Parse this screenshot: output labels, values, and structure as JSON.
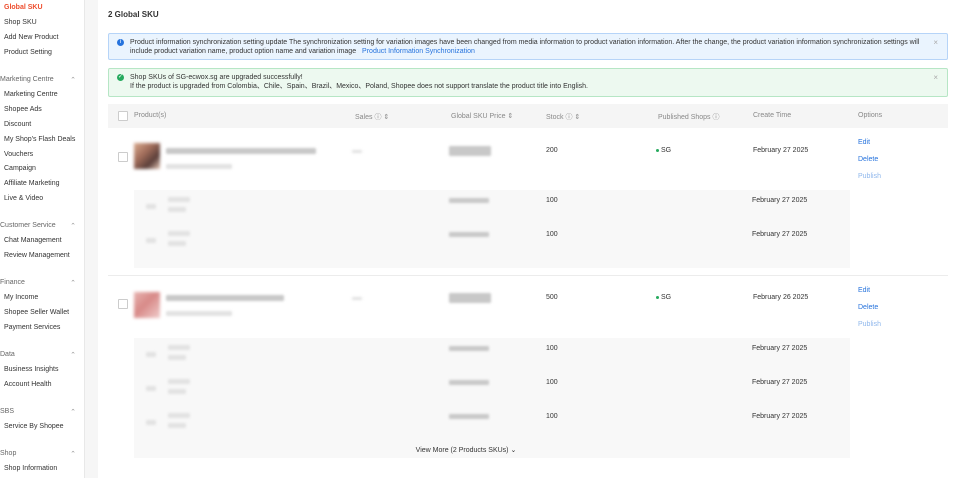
{
  "sidebar": {
    "top_items": [
      "Global SKU",
      "Shop SKU",
      "Add New Product",
      "Product Setting"
    ],
    "groups": [
      {
        "title": "Marketing Centre",
        "items": [
          "Marketing Centre",
          "Shopee Ads",
          "Discount",
          "My Shop's Flash Deals",
          "Vouchers",
          "Campaign",
          "Affiliate Marketing",
          "Live & Video"
        ]
      },
      {
        "title": "Customer Service",
        "items": [
          "Chat Management",
          "Review Management"
        ]
      },
      {
        "title": "Finance",
        "items": [
          "My Income",
          "Shopee Seller Wallet",
          "Payment Services"
        ]
      },
      {
        "title": "Data",
        "items": [
          "Business Insights",
          "Account Health"
        ]
      },
      {
        "title": "SBS",
        "items": [
          "Service By Shopee"
        ]
      },
      {
        "title": "Shop",
        "items": [
          "Shop Information"
        ]
      }
    ],
    "chevron": "chevron-up-icon"
  },
  "main": {
    "title": "2 Global SKU",
    "info_alert": {
      "text": "Product information synchronization setting update The synchronization setting for variation images have been changed from media information to product variation information. After the change, the product variation information synchronization settings will include product variation name, product option name and variation image",
      "link": "Product Information Synchronization",
      "close": "×"
    },
    "success_alert": {
      "line1": "Shop SKUs of SG-ecwox.sg are upgraded successfully!",
      "line2": "If the product is upgraded from Colombia、Chile、Spain、Brazil、Mexico、Poland, Shopee does not support translate the product title into English.",
      "close": "×"
    },
    "table": {
      "headers": {
        "product": "Product(s)",
        "sales": "Sales",
        "price": "Global SKU Price",
        "stock": "Stock",
        "shops": "Published Shops",
        "create": "Create Time",
        "options": "Options"
      },
      "products": [
        {
          "stock": "200",
          "shop": "SG",
          "create": "February 27 2025",
          "actions": [
            "Edit",
            "Delete",
            "Publish"
          ],
          "variations": [
            {
              "stock": "100",
              "create": "February 27 2025"
            },
            {
              "stock": "100",
              "create": "February 27 2025"
            }
          ]
        },
        {
          "stock": "500",
          "shop": "SG",
          "create": "February 26 2025",
          "actions": [
            "Edit",
            "Delete",
            "Publish"
          ],
          "variations": [
            {
              "stock": "100",
              "create": "February 27 2025"
            },
            {
              "stock": "100",
              "create": "February 27 2025"
            },
            {
              "stock": "100",
              "create": "February 27 2025"
            }
          ],
          "view_more": "View More (2 Products SKUs)"
        }
      ]
    }
  },
  "colors": {
    "accent": "#ee4d2d",
    "link": "#2673dd",
    "success": "#26aa5e"
  }
}
